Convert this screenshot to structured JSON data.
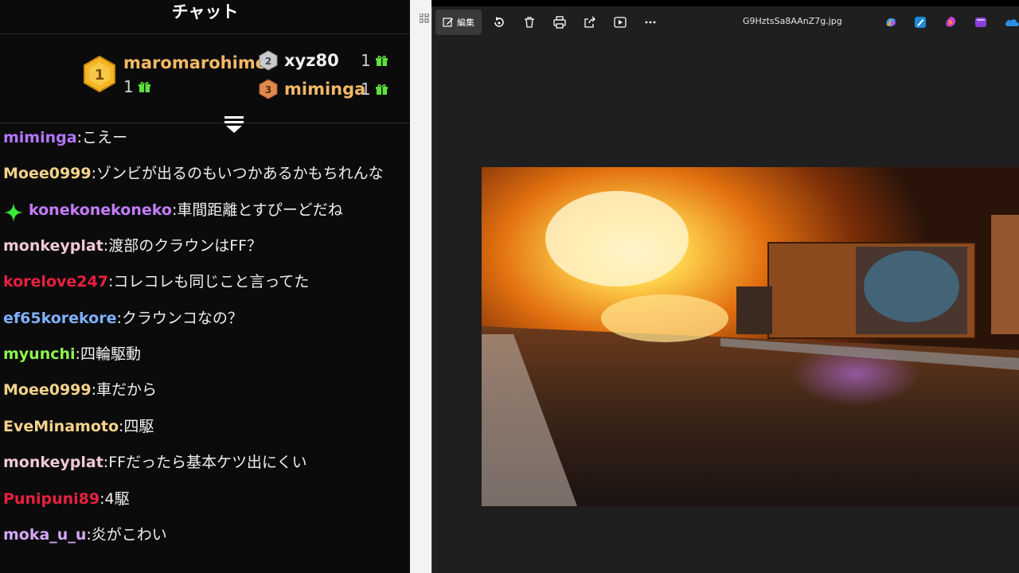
{
  "chat": {
    "title": "チャット",
    "leaderboard": [
      {
        "rank": "1",
        "name": "maromarohime",
        "count": "1",
        "color": "#f3b866"
      },
      {
        "rank": "2",
        "name": "xyz80",
        "count": "1",
        "color": "#efeff1"
      },
      {
        "rank": "3",
        "name": "miminga",
        "count": "1",
        "color": "#f3b866"
      }
    ],
    "messages": [
      {
        "user": "miminga",
        "sep": ": ",
        "text": "こえー",
        "color": "#b377ff"
      },
      {
        "user": "Moee0999",
        "sep": ": ",
        "text": "ゾンビが出るのもいつかあるかもちれんな",
        "color": "#f6d38c"
      },
      {
        "user": "konekonekoneko",
        "sep": ": ",
        "text": "車間距離とすぴーどだね",
        "color": "#c47dff",
        "badge": "sparkle-icon"
      },
      {
        "user": "monkeyplat",
        "sep": ": ",
        "text": "渡部のクラウンはFF？",
        "color": "#f0c8d8"
      },
      {
        "user": "korelove247",
        "sep": ": ",
        "text": "コレコレも同じこと言ってた",
        "color": "#e8203f"
      },
      {
        "user": "ef65korekore",
        "sep": ": ",
        "text": "クラウンコなの？",
        "color": "#7fb1ff"
      },
      {
        "user": "myunchi",
        "sep": ": ",
        "text": "四輪駆動",
        "color": "#8ef24e"
      },
      {
        "user": "Moee0999",
        "sep": ": ",
        "text": "車だから",
        "color": "#f6d38c"
      },
      {
        "user": "EveMinamoto",
        "sep": ": ",
        "text": "四駆",
        "color": "#f6d38c"
      },
      {
        "user": "monkeyplat",
        "sep": ": ",
        "text": "FFだったら基本ケツ出にくい",
        "color": "#f0c8d8"
      },
      {
        "user": "Punipuni89",
        "sep": ": ",
        "text": "4駆",
        "color": "#e8203f"
      },
      {
        "user": "moka_u_u",
        "sep": ": ",
        "text": "炎がこわい",
        "color": "#d3a7f5"
      }
    ]
  },
  "viewer": {
    "edit_label": "編集",
    "file_name": "G9HztsSa8AAnZ7g.jpg",
    "toolbar_icons": [
      "rotate-icon",
      "delete-icon",
      "print-icon",
      "share-icon",
      "slideshow-icon",
      "more-icon"
    ],
    "app_icons": [
      "copilot-icon",
      "edit-app-icon",
      "designer-icon",
      "clipchamp-icon",
      "onedrive-icon"
    ]
  }
}
